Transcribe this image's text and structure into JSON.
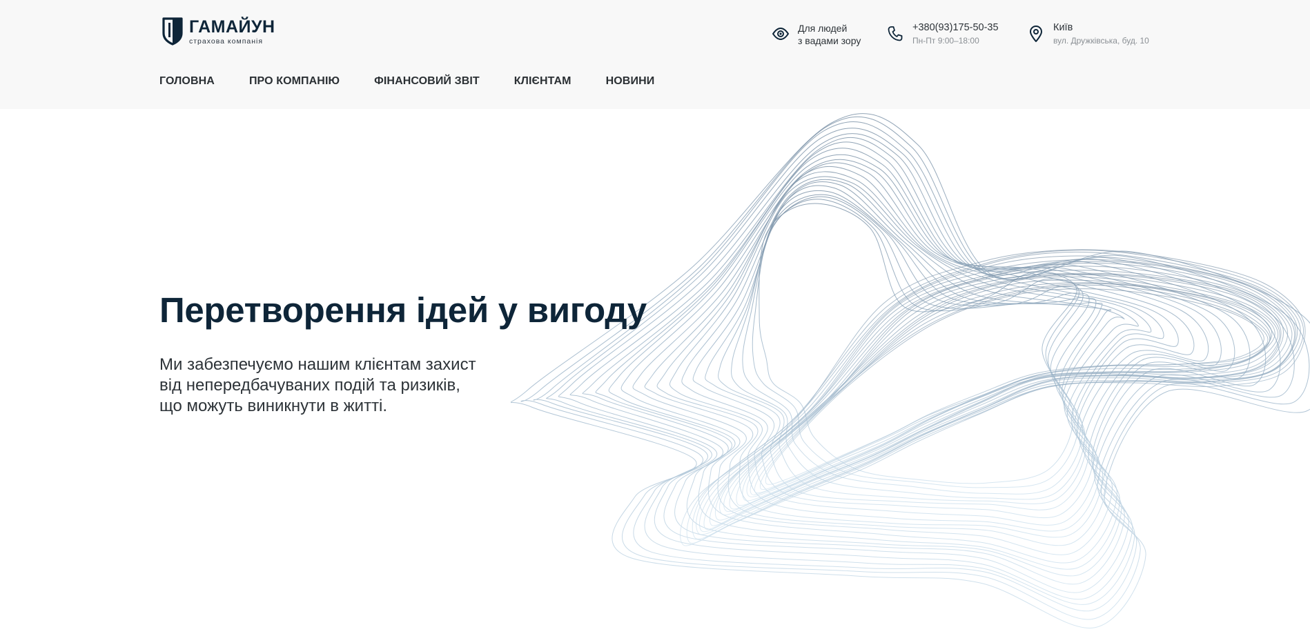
{
  "brand": {
    "name": "ГАМАЙУН",
    "subtitle": "страхова компанія"
  },
  "contacts": {
    "vision": {
      "line1": "Для людей",
      "line2": "з вадами зору",
      "icon": "eye-icon"
    },
    "phone": {
      "number": "+380(93)175-50-35",
      "hours": "Пн-Пт 9:00–18:00",
      "icon": "phone-icon"
    },
    "address": {
      "city": "Київ",
      "street": "вул. Дружківська, буд. 10",
      "icon": "location-pin-icon"
    }
  },
  "nav": {
    "items": [
      {
        "label": "ГОЛОВНА"
      },
      {
        "label": "ПРО КОМПАНІЮ"
      },
      {
        "label": "ФІНАНСОВИЙ ЗВІТ"
      },
      {
        "label": "КЛІЄНТАМ"
      },
      {
        "label": "НОВИНИ"
      }
    ]
  },
  "hero": {
    "title": "Перетворення ідей у вигоду",
    "text_lines": [
      "Ми забезпечуємо нашим клієнтам захист",
      "від непередбачуваних подій та ризиків,",
      "що можуть виникнути в житті."
    ]
  },
  "colors": {
    "header_bg": "#f8f8f8",
    "brand_dark": "#0e2538",
    "text": "#2d3338",
    "muted": "#8a8f94",
    "wave_dark": "#7d93a8",
    "wave_light": "#c6dcec"
  }
}
